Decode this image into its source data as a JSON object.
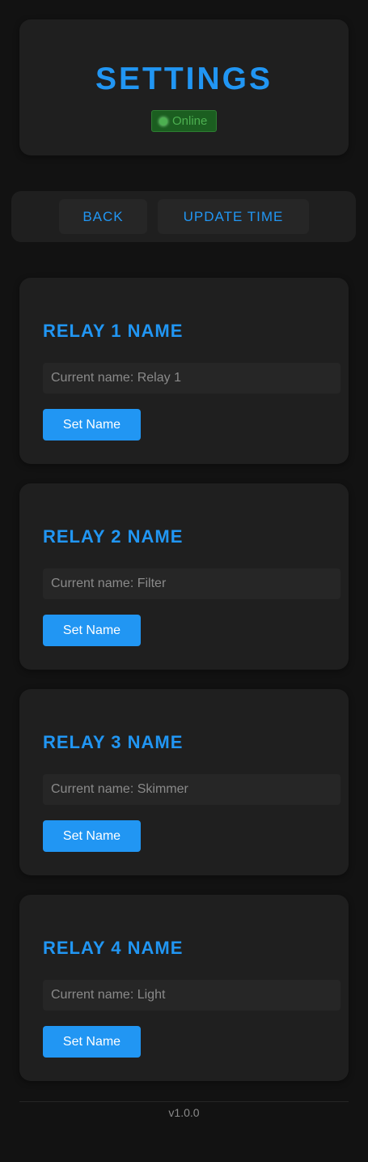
{
  "header": {
    "title": "SETTINGS",
    "status": "Online",
    "status_color": "#4caf50"
  },
  "nav": {
    "back_label": "BACK",
    "update_time_label": "UPDATE TIME"
  },
  "relays": [
    {
      "title": "RELAY 1 NAME",
      "placeholder": "Current name: Relay 1",
      "value": "",
      "button_label": "Set Name"
    },
    {
      "title": "RELAY 2 NAME",
      "placeholder": "Current name: Filter",
      "value": "",
      "button_label": "Set Name"
    },
    {
      "title": "RELAY 3 NAME",
      "placeholder": "Current name: Skimmer",
      "value": "",
      "button_label": "Set Name"
    },
    {
      "title": "RELAY 4 NAME",
      "placeholder": "Current name: Light",
      "value": "",
      "button_label": "Set Name"
    }
  ],
  "footer": {
    "version": "v1.0.0"
  },
  "colors": {
    "accent": "#2196f3",
    "background": "#121212",
    "card": "#1f1f1f"
  }
}
